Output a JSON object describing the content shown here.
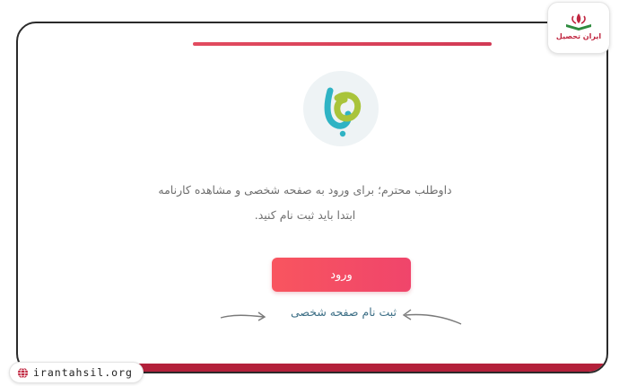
{
  "brand": {
    "name": "ایران تحصیل",
    "accent_color": "#c0253f",
    "icon": "book-tulip-icon"
  },
  "watermark": {
    "url": "irantahsil.org",
    "icon": "globe-icon"
  },
  "card": {
    "logo_icon": "app-logo-icon",
    "message_line_1": "داوطلب محترم؛ برای ورود به صفحه شخصی و مشاهده کارنامه",
    "message_line_2": "ابتدا باید ثبت نام کنید.",
    "login_label": "ورود",
    "register_label": "ثبت نام صفحه شخصی",
    "accent_color": "#f2506a"
  }
}
